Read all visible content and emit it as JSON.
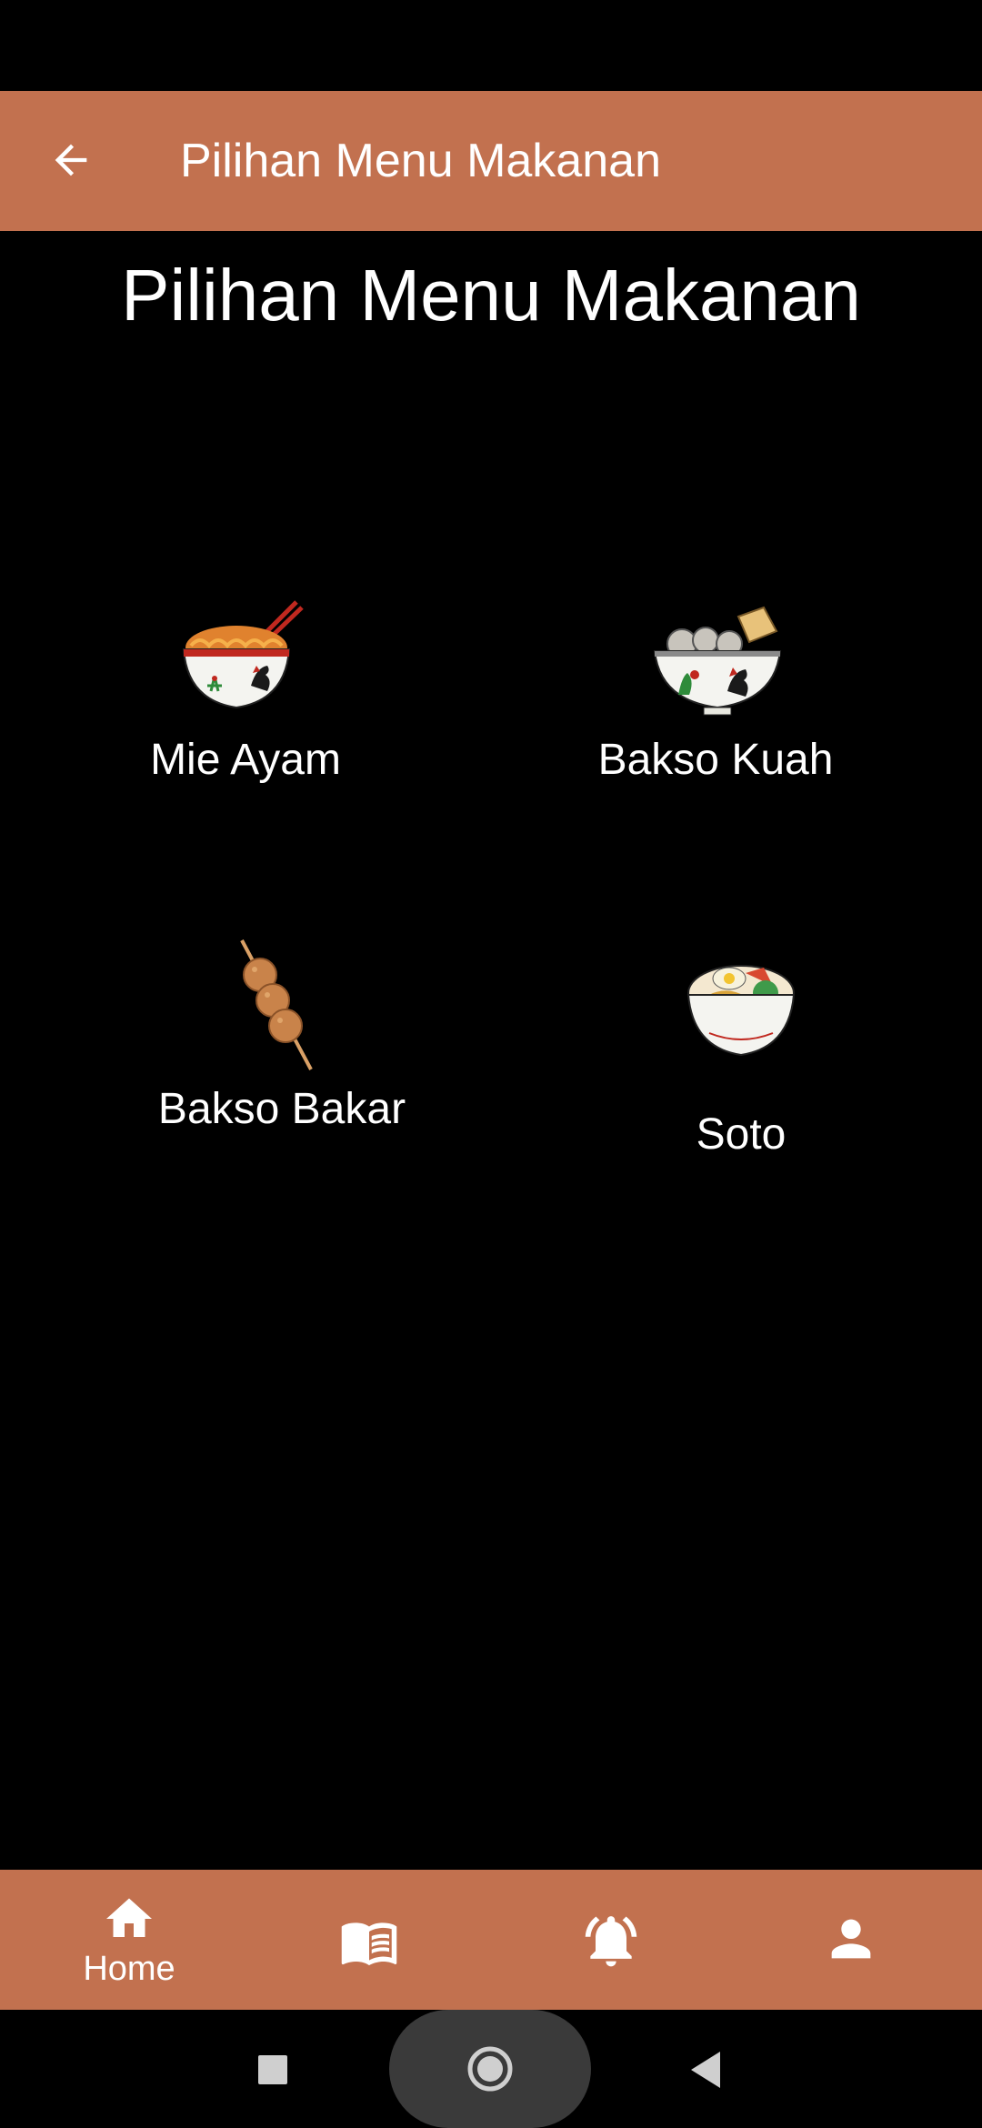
{
  "app_bar": {
    "title": "Pilihan Menu Makanan",
    "back_icon": "arrow-back-icon"
  },
  "page": {
    "heading": "Pilihan Menu Makanan"
  },
  "menu": {
    "items": [
      {
        "label": "Mie Ayam",
        "icon": "noodle-bowl-icon"
      },
      {
        "label": "Bakso Kuah",
        "icon": "meatball-soup-icon"
      },
      {
        "label": "Bakso Bakar",
        "icon": "meatball-skewer-icon"
      },
      {
        "label": "Soto",
        "icon": "soto-bowl-icon"
      }
    ]
  },
  "bottom_nav": {
    "items": [
      {
        "label": "Home",
        "icon": "home-icon",
        "active": true
      },
      {
        "label": "",
        "icon": "book-icon"
      },
      {
        "label": "",
        "icon": "alarm-bell-icon"
      },
      {
        "label": "",
        "icon": "person-icon"
      }
    ]
  },
  "colors": {
    "accent": "#C2714F",
    "background": "#000000",
    "text": "#FFFFFF"
  }
}
